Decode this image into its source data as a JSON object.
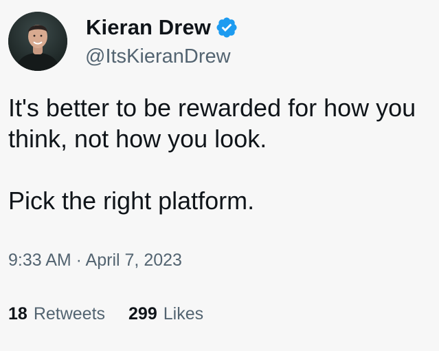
{
  "author": {
    "name": "Kieran Drew",
    "handle": "@ItsKieranDrew",
    "verified": true,
    "avatar": "profile-photo"
  },
  "tweet": {
    "lines": [
      "It's better to be rewarded for how you think, not how you look.",
      "Pick the right platform."
    ],
    "timestamp": "9:33 AM · April 7, 2023"
  },
  "stats": {
    "retweets": {
      "count": "18",
      "label": "Retweets"
    },
    "likes": {
      "count": "299",
      "label": "Likes"
    }
  },
  "colors": {
    "background": "#f7f7f7",
    "text": "#0f1419",
    "secondary_text": "#536471",
    "verified_blue": "#1d9bf0"
  }
}
